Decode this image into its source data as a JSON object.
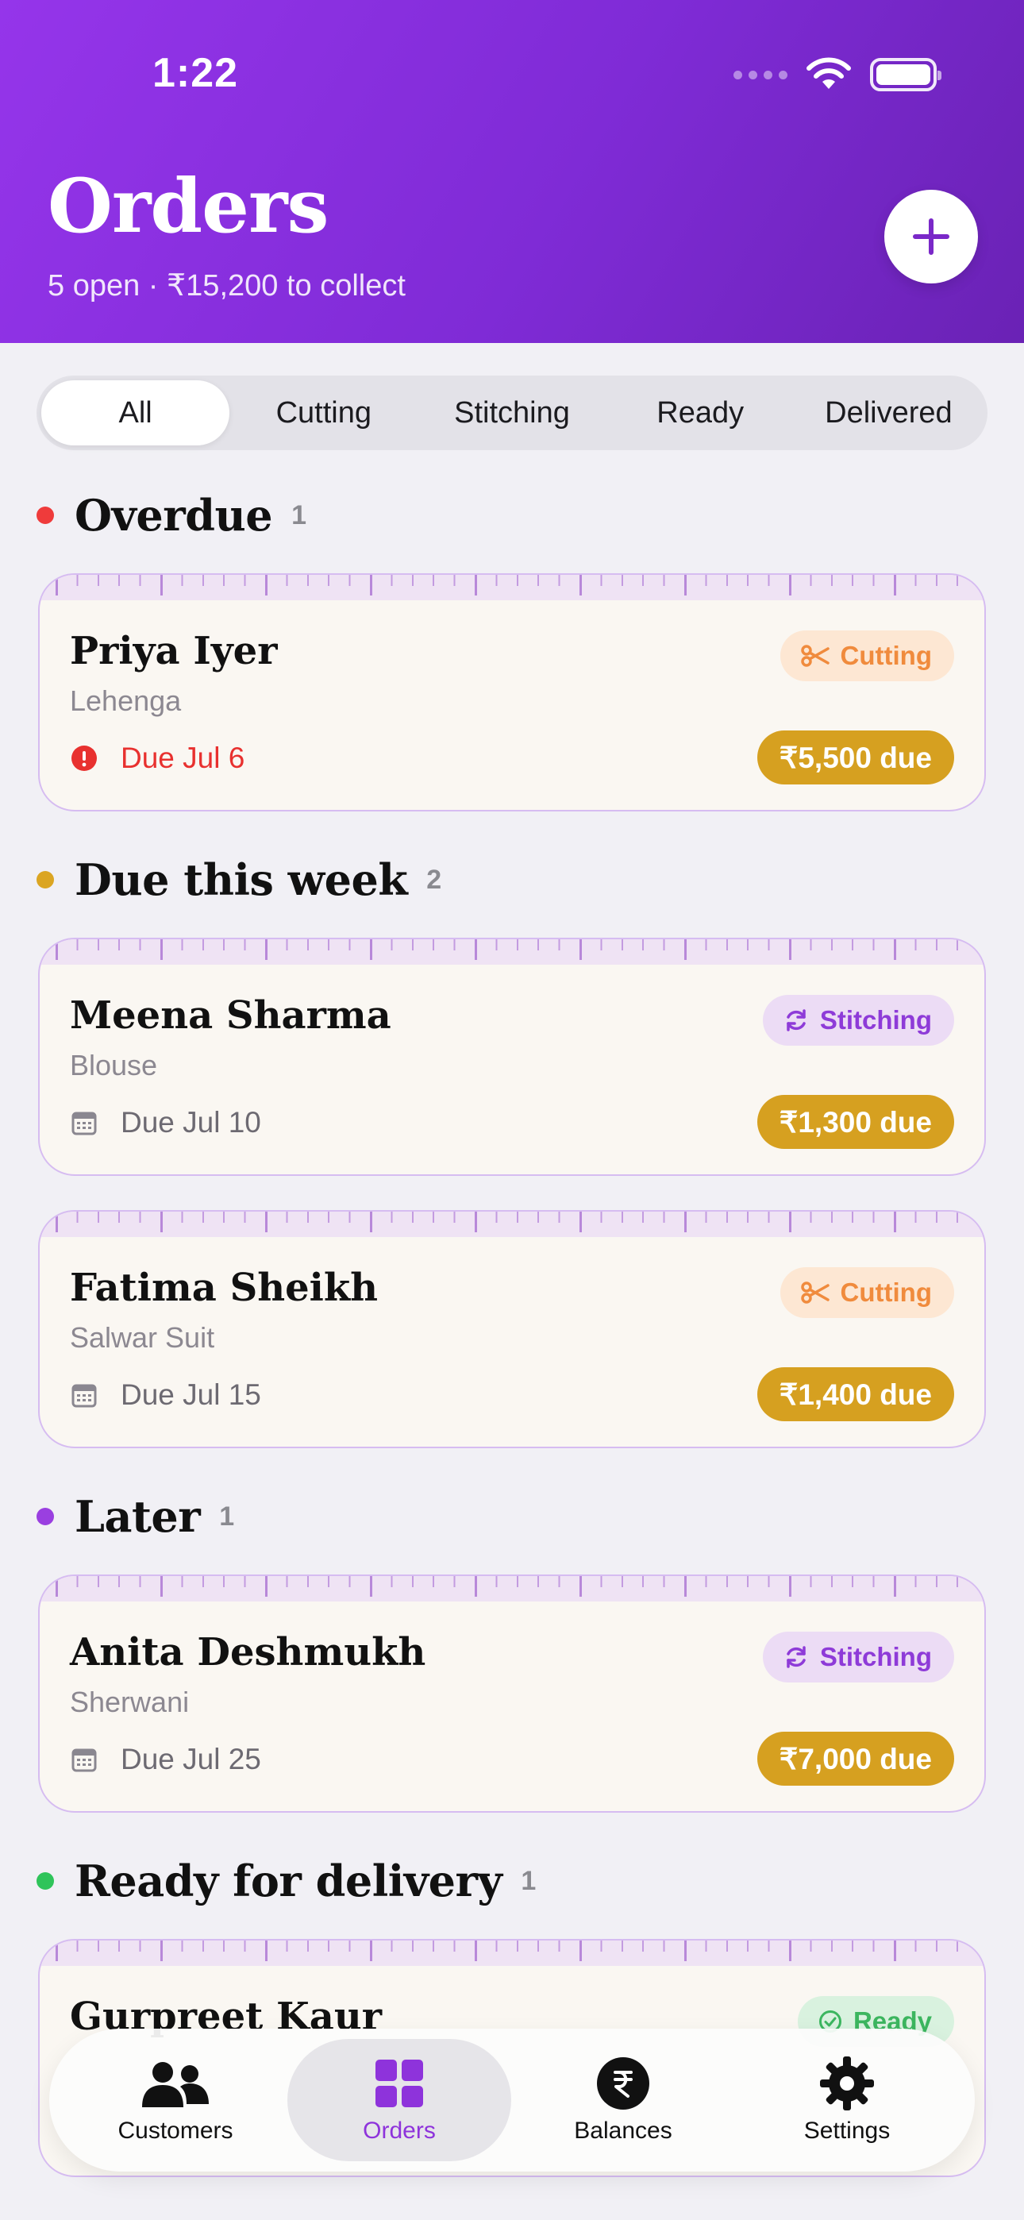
{
  "status_bar": {
    "time": "1:22"
  },
  "header": {
    "title": "Orders",
    "subtitle": "5 open · ₹15,200 to collect"
  },
  "filters": {
    "tabs": [
      "All",
      "Cutting",
      "Stitching",
      "Ready",
      "Delivered"
    ],
    "active": "All"
  },
  "sections": [
    {
      "title": "Overdue",
      "count": "1",
      "color": "#ef3b3b"
    },
    {
      "title": "Due this week",
      "count": "2",
      "color": "#dba522"
    },
    {
      "title": "Later",
      "count": "1",
      "color": "#9a3fe0"
    },
    {
      "title": "Ready for delivery",
      "count": "1",
      "color": "#2fc45a"
    }
  ],
  "orders": [
    {
      "name": "Priya Iyer",
      "garment": "Lehenga",
      "due": "Due Jul 6",
      "stage": "Cutting",
      "amount": "₹5,500 due",
      "overdue": true
    },
    {
      "name": "Meena Sharma",
      "garment": "Blouse",
      "due": "Due Jul 10",
      "stage": "Stitching",
      "amount": "₹1,300 due"
    },
    {
      "name": "Fatima Sheikh",
      "garment": "Salwar Suit",
      "due": "Due Jul 15",
      "stage": "Cutting",
      "amount": "₹1,400 due"
    },
    {
      "name": "Anita Deshmukh",
      "garment": "Sherwani",
      "due": "Due Jul 25",
      "stage": "Stitching",
      "amount": "₹7,000 due"
    },
    {
      "name": "Gurpreet Kaur",
      "stage": "Ready"
    }
  ],
  "bottom_nav": {
    "items": [
      "Customers",
      "Orders",
      "Balances",
      "Settings"
    ],
    "active": "Orders"
  },
  "icons": {
    "add": "plus-icon",
    "cutting": "scissors-icon",
    "stitching": "refresh-icon",
    "ready": "check-circle-icon",
    "due": "calendar-icon",
    "overdue": "alert-circle-icon"
  }
}
